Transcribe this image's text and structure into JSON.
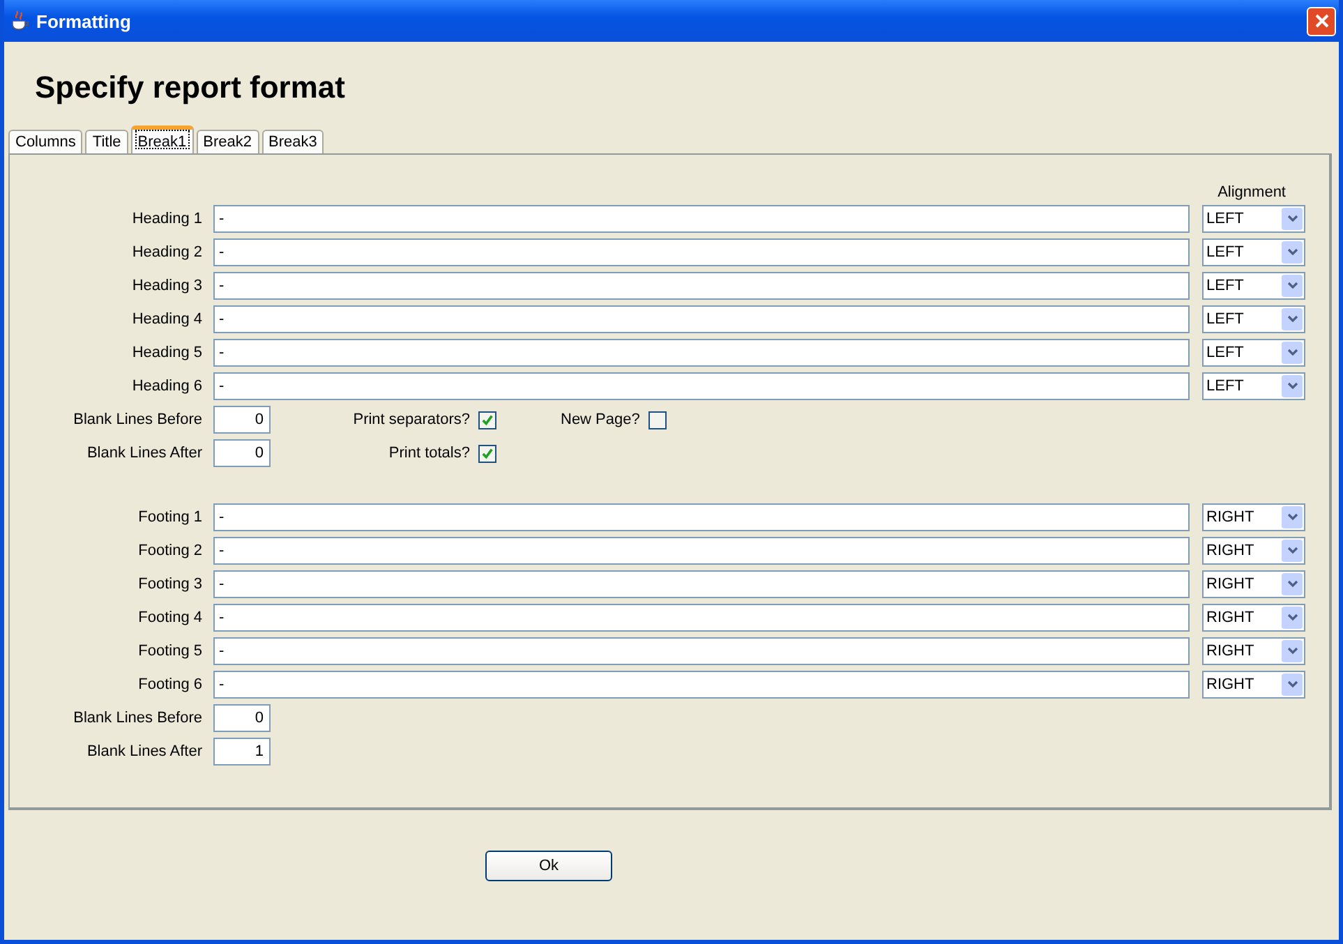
{
  "window": {
    "title": "Formatting"
  },
  "heading": "Specify report format",
  "tabs": [
    {
      "label": "Columns",
      "selected": false
    },
    {
      "label": "Title",
      "selected": false
    },
    {
      "label": "Break1",
      "selected": true
    },
    {
      "label": "Break2",
      "selected": false
    },
    {
      "label": "Break3",
      "selected": false
    }
  ],
  "alignment_header": "Alignment",
  "sections": [
    {
      "lines": [
        {
          "label": "Heading 1",
          "value": "-",
          "alignment": "LEFT"
        },
        {
          "label": "Heading 2",
          "value": "-",
          "alignment": "LEFT"
        },
        {
          "label": "Heading 3",
          "value": "-",
          "alignment": "LEFT"
        },
        {
          "label": "Heading 4",
          "value": "-",
          "alignment": "LEFT"
        },
        {
          "label": "Heading 5",
          "value": "-",
          "alignment": "LEFT"
        },
        {
          "label": "Heading 6",
          "value": "-",
          "alignment": "LEFT"
        }
      ],
      "blank_lines": [
        {
          "label": "Blank Lines Before",
          "value": "0",
          "options": [
            {
              "label": "Print separators?",
              "checked": true
            },
            {
              "label": "New Page?",
              "checked": false
            }
          ]
        },
        {
          "label": "Blank Lines After",
          "value": "0",
          "options": [
            {
              "label": "Print totals?",
              "checked": true
            }
          ]
        }
      ]
    },
    {
      "lines": [
        {
          "label": "Footing 1",
          "value": "-",
          "alignment": "RIGHT"
        },
        {
          "label": "Footing 2",
          "value": "-",
          "alignment": "RIGHT"
        },
        {
          "label": "Footing 3",
          "value": "-",
          "alignment": "RIGHT"
        },
        {
          "label": "Footing 4",
          "value": "-",
          "alignment": "RIGHT"
        },
        {
          "label": "Footing 5",
          "value": "-",
          "alignment": "RIGHT"
        },
        {
          "label": "Footing 6",
          "value": "-",
          "alignment": "RIGHT"
        }
      ],
      "blank_lines": [
        {
          "label": "Blank Lines Before",
          "value": "0"
        },
        {
          "label": "Blank Lines After",
          "value": "1"
        }
      ]
    }
  ],
  "buttons": [
    "Ok"
  ]
}
